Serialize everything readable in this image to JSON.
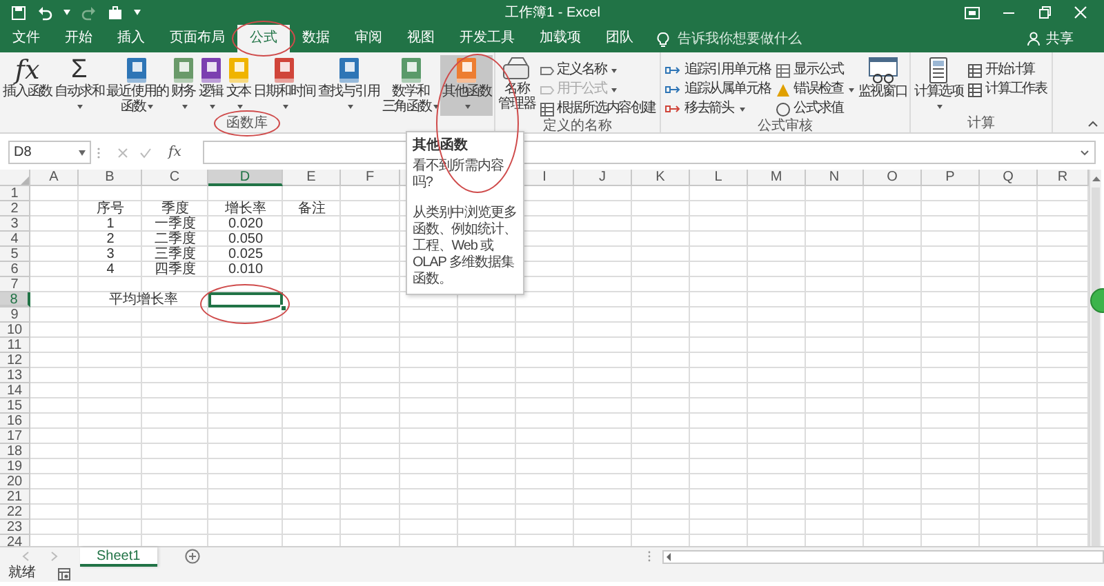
{
  "window": {
    "title": "工作簿1 - Excel"
  },
  "tabs": [
    {
      "label": "文件",
      "selected": false
    },
    {
      "label": "开始",
      "selected": false
    },
    {
      "label": "插入",
      "selected": false
    },
    {
      "label": "页面布局",
      "selected": false
    },
    {
      "label": "公式",
      "selected": true,
      "circled": true
    },
    {
      "label": "数据",
      "selected": false
    },
    {
      "label": "审阅",
      "selected": false
    },
    {
      "label": "视图",
      "selected": false
    },
    {
      "label": "开发工具",
      "selected": false
    },
    {
      "label": "加载项",
      "selected": false
    },
    {
      "label": "团队",
      "selected": false
    }
  ],
  "tell_me": {
    "placeholder": "告诉我你想要做什么"
  },
  "share": {
    "label": "共享"
  },
  "ribbon": {
    "groups": [
      {
        "label": "函数库",
        "label_circled": true,
        "buttons": [
          {
            "kind": "large",
            "label": [
              "插入函数"
            ],
            "icon_text": "fx",
            "dropdown": false,
            "pressed": false,
            "disabled": false
          },
          {
            "kind": "large",
            "label": [
              "自动求和"
            ],
            "icon_text": "Σ",
            "dropdown": true,
            "pressed": false,
            "disabled": false
          },
          {
            "kind": "large",
            "label": [
              "最近使用的",
              "函数"
            ],
            "dropdown": true,
            "pressed": false,
            "disabled": false
          },
          {
            "kind": "large",
            "label": [
              "财务"
            ],
            "dropdown": true,
            "pressed": false,
            "disabled": false
          },
          {
            "kind": "large",
            "label": [
              "逻辑"
            ],
            "dropdown": true,
            "pressed": false,
            "disabled": false
          },
          {
            "kind": "large",
            "label": [
              "文本"
            ],
            "dropdown": true,
            "pressed": false,
            "disabled": false
          },
          {
            "kind": "large",
            "label": [
              "日期和时间"
            ],
            "dropdown": true,
            "pressed": false,
            "disabled": false
          },
          {
            "kind": "large",
            "label": [
              "查找与引用"
            ],
            "dropdown": true,
            "pressed": false,
            "disabled": false
          },
          {
            "kind": "large",
            "label": [
              "数学和",
              "三角函数"
            ],
            "dropdown": true,
            "pressed": false,
            "disabled": false
          },
          {
            "kind": "large",
            "label": [
              "其他函数"
            ],
            "dropdown": true,
            "pressed": true,
            "disabled": false,
            "circled": true,
            "tooltip": {
              "title": "其他函数",
              "question": "看不到所需内容吗?",
              "body": "从类别中浏览更多函数、例如统计、工程、Web 或 OLAP 多维数据集函数。"
            }
          }
        ]
      },
      {
        "label": "定义的名称",
        "buttons": [
          {
            "kind": "large",
            "label": [
              "名称",
              "管理器"
            ],
            "dropdown": false,
            "pressed": false,
            "disabled": false
          },
          {
            "kind": "small",
            "label": [
              "定义名称"
            ],
            "dropdown": true,
            "pressed": false,
            "disabled": false
          },
          {
            "kind": "small",
            "label": [
              "用于公式"
            ],
            "dropdown": true,
            "pressed": false,
            "disabled": true
          },
          {
            "kind": "small",
            "label": [
              "根据所选内容创建"
            ],
            "dropdown": false,
            "pressed": false,
            "disabled": false
          }
        ]
      },
      {
        "label": "公式审核",
        "buttons": [
          {
            "kind": "small",
            "label": [
              "追踪引用单元格"
            ],
            "dropdown": false,
            "pressed": false,
            "disabled": false
          },
          {
            "kind": "small",
            "label": [
              "追踪从属单元格"
            ],
            "dropdown": false,
            "pressed": false,
            "disabled": false
          },
          {
            "kind": "small",
            "label": [
              "移去箭头"
            ],
            "dropdown": true,
            "pressed": false,
            "disabled": false
          },
          {
            "kind": "small",
            "label": [
              "显示公式"
            ],
            "dropdown": false,
            "pressed": false,
            "disabled": false
          },
          {
            "kind": "small",
            "label": [
              "错误检查"
            ],
            "dropdown": true,
            "pressed": false,
            "disabled": false
          },
          {
            "kind": "small",
            "label": [
              "公式求值"
            ],
            "dropdown": false,
            "pressed": false,
            "disabled": false
          },
          {
            "kind": "large",
            "label": [
              "监视窗口"
            ],
            "dropdown": false,
            "pressed": false,
            "disabled": false
          }
        ]
      },
      {
        "label": "计算",
        "buttons": [
          {
            "kind": "large",
            "label": [
              "计算选项"
            ],
            "dropdown": true,
            "pressed": false,
            "disabled": false
          },
          {
            "kind": "small",
            "label": [
              "开始计算"
            ],
            "dropdown": false,
            "pressed": false,
            "disabled": false
          },
          {
            "kind": "small",
            "label": [
              "计算工作表"
            ],
            "dropdown": false,
            "pressed": false,
            "disabled": false
          }
        ]
      }
    ]
  },
  "formula_bar": {
    "name_box": "D8",
    "function_button": "fx"
  },
  "sheet": {
    "columns": [
      "A",
      "B",
      "C",
      "D",
      "E",
      "F",
      null,
      null,
      "I",
      "J",
      "K",
      "L",
      "M",
      "N",
      "O",
      "P",
      "Q",
      "R"
    ],
    "rows": [
      {
        "header": "1"
      },
      {
        "header": "2",
        "cells": {
          "B": {
            "text": "序号",
            "selected": false
          },
          "C": {
            "text": "季度",
            "selected": false
          },
          "D": {
            "text": "增长率",
            "selected": false
          },
          "E": {
            "text": "备注",
            "selected": false
          }
        }
      },
      {
        "header": "3",
        "cells": {
          "B": {
            "text": "1",
            "selected": false
          },
          "C": {
            "text": "一季度",
            "selected": false
          },
          "D": {
            "text": "0.020",
            "selected": false
          }
        }
      },
      {
        "header": "4",
        "cells": {
          "B": {
            "text": "2",
            "selected": false
          },
          "C": {
            "text": "二季度",
            "selected": false
          },
          "D": {
            "text": "0.050",
            "selected": false
          }
        }
      },
      {
        "header": "5",
        "cells": {
          "B": {
            "text": "3",
            "selected": false
          },
          "C": {
            "text": "三季度",
            "selected": false
          },
          "D": {
            "text": "0.025",
            "selected": false
          }
        }
      },
      {
        "header": "6",
        "cells": {
          "B": {
            "text": "4",
            "selected": false
          },
          "C": {
            "text": "四季度",
            "selected": false
          },
          "D": {
            "text": "0.010",
            "selected": false
          }
        }
      },
      {
        "header": "7"
      },
      {
        "header": "8",
        "cells": {
          "B": {
            "text": "平均增长率",
            "merged": true,
            "selected": false
          },
          "D": {
            "selected": true,
            "circled": true
          }
        }
      },
      {
        "header": "9"
      },
      {
        "header": "10"
      },
      {
        "header": "11"
      },
      {
        "header": "12"
      },
      {
        "header": "13"
      },
      {
        "header": "14"
      },
      {
        "header": "15"
      },
      {
        "header": "16"
      },
      {
        "header": "17"
      },
      {
        "header": "18"
      },
      {
        "header": "19"
      },
      {
        "header": "20"
      },
      {
        "header": "21"
      },
      {
        "header": "22"
      },
      {
        "header": "23"
      },
      {
        "header": "24"
      }
    ]
  },
  "sheet_tabs": [
    {
      "name": "Sheet1",
      "selected": true
    }
  ],
  "status_bar": {
    "text": "就绪"
  }
}
